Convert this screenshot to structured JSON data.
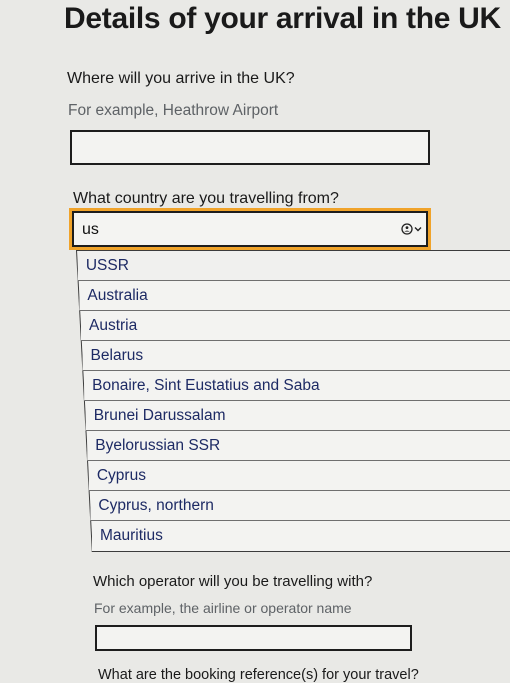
{
  "page": {
    "heading": "Details of your arrival in the UK"
  },
  "arrival": {
    "label": "Where will you arrive in the UK?",
    "hint": "For example, Heathrow Airport",
    "value": ""
  },
  "country": {
    "label": "What country are you travelling from?",
    "value": "us",
    "options": [
      "USSR",
      "Australia",
      "Austria",
      "Belarus",
      "Bonaire, Sint Eustatius and Saba",
      "Brunei Darussalam",
      "Byelorussian SSR",
      "Cyprus",
      "Cyprus, northern",
      "Mauritius"
    ]
  },
  "operator": {
    "label": "Which operator will you be travelling with?",
    "hint": "For example, the airline or operator name",
    "value": ""
  },
  "booking": {
    "label": "What are the booking reference(s) for your travel?"
  },
  "icons": {
    "clear": "clear-circle-icon",
    "dropdown": "chevron-down-icon"
  }
}
